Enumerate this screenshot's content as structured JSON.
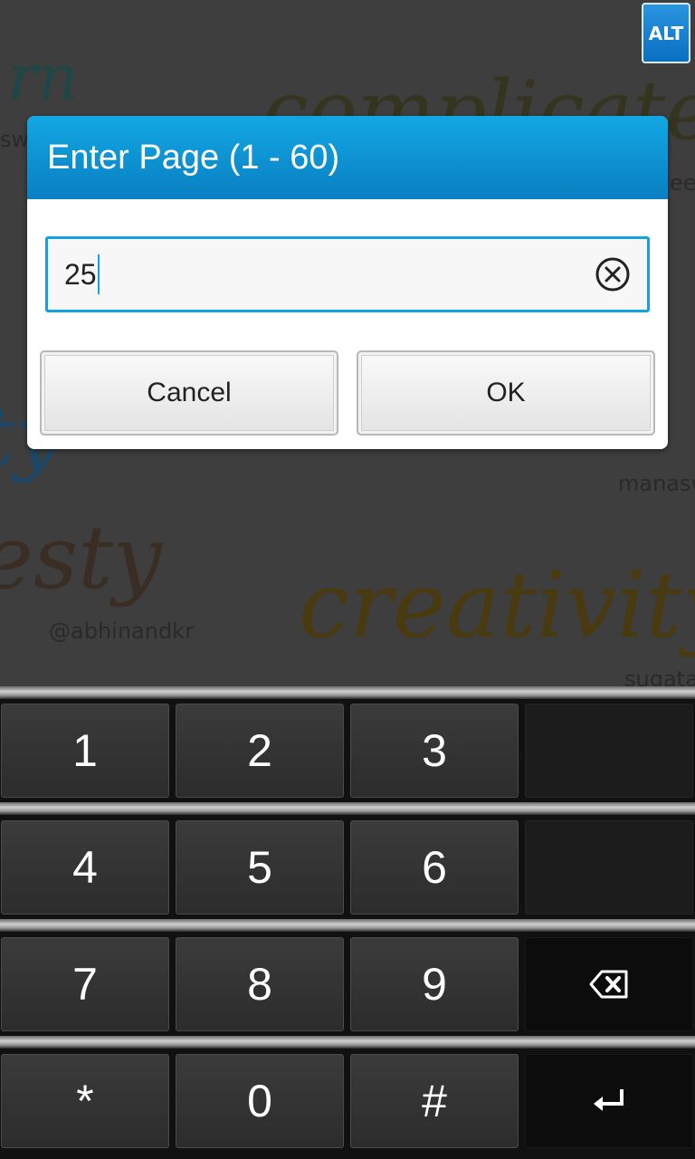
{
  "background": {
    "scribbles": [
      "rn",
      "complicate",
      "esty",
      "creativity",
      "ty"
    ],
    "handles": [
      "sw",
      "ee",
      "manasw",
      "@abhinandkr",
      "sugata"
    ]
  },
  "alt_label": "ALT",
  "dialog": {
    "title": "Enter Page (1 - 60)",
    "input_value": "25",
    "clear_icon": "clear-circle-x-icon",
    "cancel_label": "Cancel",
    "ok_label": "OK"
  },
  "keypad": {
    "keys": [
      "1",
      "2",
      "3",
      "4",
      "5",
      "6",
      "7",
      "8",
      "9",
      "*",
      "0",
      "#"
    ],
    "backspace_icon": "backspace-icon",
    "enter_icon": "enter-return-icon"
  },
  "colors": {
    "accent": "#0a8fd6",
    "focus_border": "#13a1e0"
  }
}
